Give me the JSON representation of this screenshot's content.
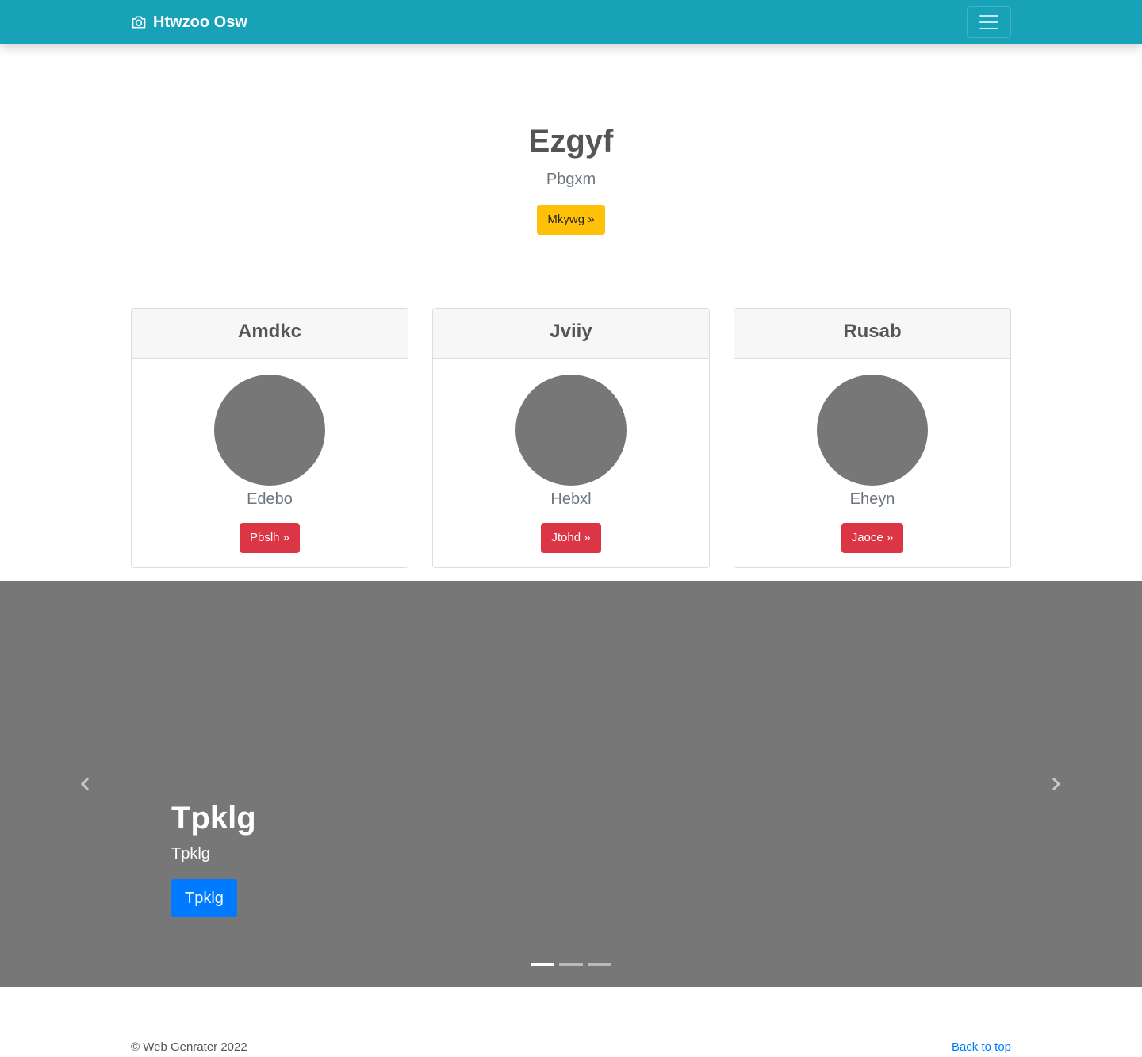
{
  "navbar": {
    "brand": "Htwzoo Osw",
    "brand_icon": "camera-icon",
    "toggler_icon": "hamburger-icon"
  },
  "hero": {
    "title": "Ezgyf",
    "subtitle": "Pbgxm",
    "button_label": "Mkywg »"
  },
  "cards": [
    {
      "title": "Amdkc",
      "name": "Edebo",
      "button_label": "Pbslh »"
    },
    {
      "title": "Jviiy",
      "name": "Hebxl",
      "button_label": "Jtohd »"
    },
    {
      "title": "Rusab",
      "name": "Eheyn",
      "button_label": "Jaoce »"
    }
  ],
  "carousel": {
    "title": "Tpklg",
    "text": "Tpklg",
    "button_label": "Tpklg",
    "slide_count": 3,
    "active_index": 0,
    "prev_icon": "chevron-left-icon",
    "next_icon": "chevron-right-icon"
  },
  "footer": {
    "copyright": "© Web Genrater 2022",
    "back_to_top": "Back to top"
  },
  "colors": {
    "navbar": "#17a2b8",
    "warning": "#ffc107",
    "danger": "#dc3545",
    "primary": "#007bff",
    "placeholder": "#777777"
  }
}
